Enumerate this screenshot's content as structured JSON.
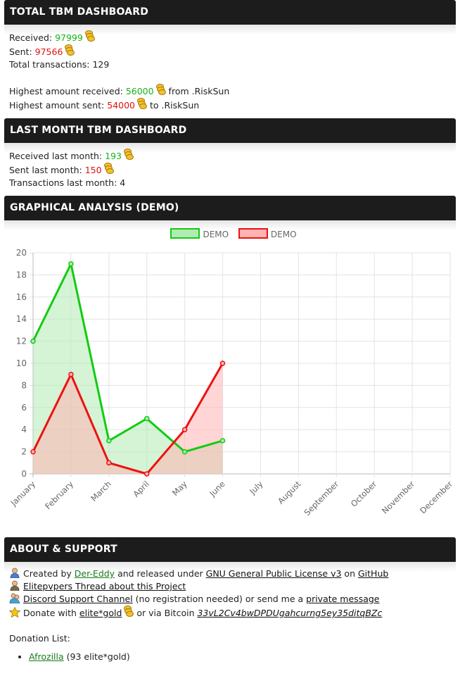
{
  "total": {
    "title": "TOTAL TBM DASHBOARD",
    "received_label": "Received: ",
    "received_value": "97999",
    "sent_label": "Sent: ",
    "sent_value": "97566",
    "transactions": "Total transactions: 129",
    "highest_received_label": "Highest amount received: ",
    "highest_received_value": "56000",
    "highest_received_suffix": " from .RiskSun",
    "highest_sent_label": "Highest amount sent: ",
    "highest_sent_value": "54000",
    "highest_sent_suffix": " to .RiskSun"
  },
  "lastmonth": {
    "title": "LAST MONTH TBM DASHBOARD",
    "received_label": "Received last month: ",
    "received_value": "193",
    "sent_label": "Sent last month: ",
    "sent_value": "150",
    "transactions": "Transactions last month: 4"
  },
  "graph": {
    "title": "GRAPHICAL ANALYSIS (DEMO)"
  },
  "chart_data": {
    "type": "line",
    "categories": [
      "January",
      "February",
      "March",
      "April",
      "May",
      "June",
      "July",
      "August",
      "September",
      "October",
      "November",
      "December"
    ],
    "series": [
      {
        "name": "DEMO",
        "color": "#11cc11",
        "fill": "#b3eab3",
        "values": [
          12,
          19,
          3,
          5,
          2,
          3
        ]
      },
      {
        "name": "DEMO",
        "color": "#ee1111",
        "fill": "#ffb3b3",
        "values": [
          2,
          9,
          1,
          0,
          4,
          10
        ]
      }
    ],
    "yticks": [
      "0",
      "2",
      "4",
      "6",
      "8",
      "10",
      "12",
      "14",
      "16",
      "18",
      "20"
    ],
    "ylim": [
      0,
      20
    ],
    "grid": true,
    "legend": "top-center"
  },
  "about": {
    "title": "ABOUT & SUPPORT",
    "created_prefix": "Created by ",
    "author": "Der-Eddy",
    "created_middle": " and released under ",
    "license": "GNU General Public License v3",
    "created_on": " on ",
    "github": "GitHub",
    "thread_link": "Elitepvpers Thread about this Project",
    "discord_link": "Discord Support Channel",
    "discord_middle": " (no registration needed) or send me a ",
    "pm_link": "private message",
    "donate_prefix": "Donate with ",
    "egold_link": "elite*gold",
    "donate_middle": " or via Bitcoin ",
    "bitcoin": "33vL2Cv4bwDPDUgahcurng5ey35ditqBZc",
    "donation_list_label": "Donation List:",
    "donor_name": "Afrozilla",
    "donor_amount": " (93 elite*gold)"
  }
}
